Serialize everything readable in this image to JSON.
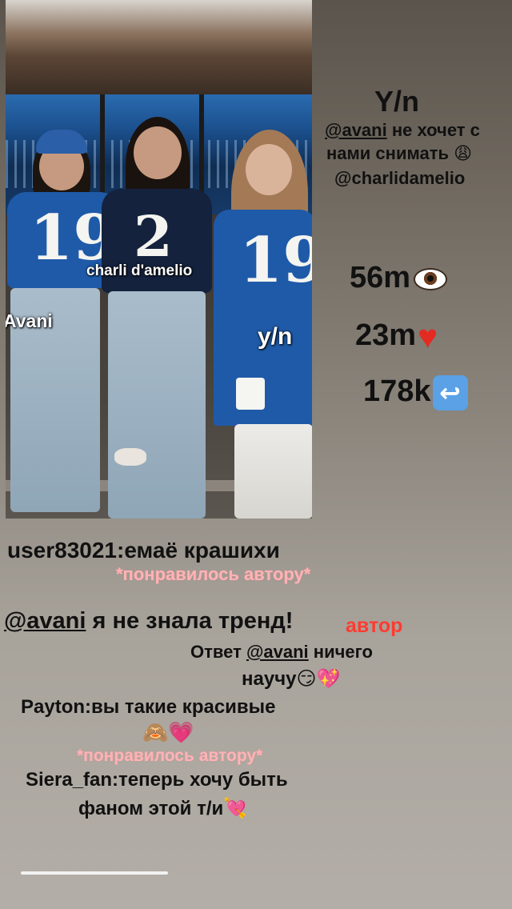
{
  "video": {
    "label_left": "Avani",
    "label_center": "charli d'amelio",
    "label_right": "y/n",
    "jersey_number": "19"
  },
  "header": {
    "title": "Y/n",
    "caption_mention": "@avani",
    "caption_line1_rest": " не хочет с",
    "caption_line2": "нами снимать",
    "caption_line2_emoji": "😩",
    "caption_line3": "@charlidamelio"
  },
  "stats": {
    "views": "56m",
    "likes": "23m",
    "reposts": "178k"
  },
  "comments": {
    "c1_text": "user83021:емаё крашихи",
    "c1_liked": "*понравилось автору*",
    "c2_mention": "@avani",
    "c2_rest": " я не знала тренд!",
    "c2_tag": "автор",
    "c3_prefix": "Ответ ",
    "c3_mention": "@avani",
    "c3_rest": " ничего",
    "c3_line2": "научу",
    "c3_emojis": "😏💖",
    "c4_text": "Payton:вы такие красивые",
    "c4_emojis": "🙈💗",
    "c4_liked": "*понравилось автору*",
    "c5_line1": "Siera_fan:теперь хочу быть",
    "c5_line2": "фаном этой т/и",
    "c5_emoji": "💘"
  },
  "colors": {
    "liked_pink": "#ffb3b6",
    "author_red": "#ff3b30",
    "jersey_blue": "#1f5aa8"
  }
}
